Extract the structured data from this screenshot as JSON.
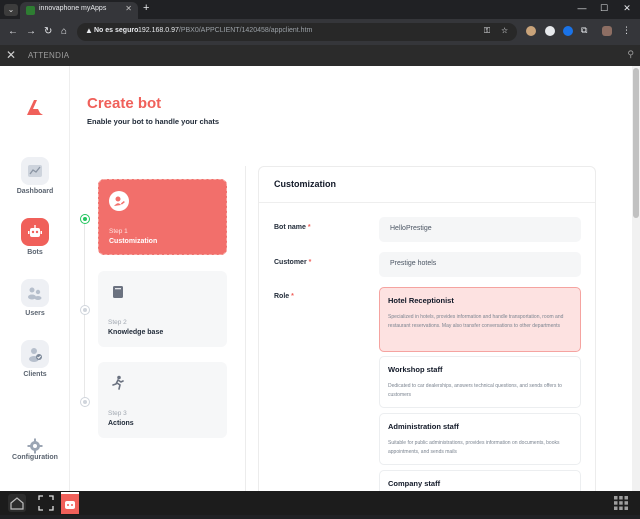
{
  "browser": {
    "tab_title": "innovaphone myApps",
    "security_label": "No es seguro",
    "url_host": "192.168.0.97",
    "url_path": "/PBX0/APPCLIENT/1420458/appclient.htm"
  },
  "appbar": {
    "title": "ATTENDIA"
  },
  "sidebar": {
    "items": [
      {
        "label": "Dashboard",
        "icon": "chart-icon"
      },
      {
        "label": "Bots",
        "icon": "robot-icon",
        "active": true
      },
      {
        "label": "Users",
        "icon": "users-icon"
      },
      {
        "label": "Clients",
        "icon": "client-check-icon"
      },
      {
        "label": "Configuration",
        "icon": "gear-icon"
      }
    ]
  },
  "header": {
    "title": "Create bot",
    "subtitle": "Enable your bot to handle your chats"
  },
  "steps": [
    {
      "number": "Step 1",
      "name": "Customization",
      "icon": "user-edit-icon",
      "active": true
    },
    {
      "number": "Step 2",
      "name": "Knowledge base",
      "icon": "book-icon"
    },
    {
      "number": "Step 3",
      "name": "Actions",
      "icon": "running-icon"
    }
  ],
  "panel": {
    "title": "Customization",
    "fields": {
      "bot_name": {
        "label": "Bot name",
        "required": "*",
        "value": "HelloPrestige"
      },
      "customer": {
        "label": "Customer",
        "required": "*",
        "value": "Prestige hotels"
      },
      "role": {
        "label": "Role",
        "required": "*"
      }
    },
    "roles": [
      {
        "name": "Hotel Receptionist",
        "desc": "Specialized in hotels, provides information and handle transportation, room and restaurant reservations. May also transfer conversations to other departments",
        "selected": true
      },
      {
        "name": "Workshop staff",
        "desc": "Dedicated to car dealerships, answers technical questions, and sends offers to customers"
      },
      {
        "name": "Administration staff",
        "desc": "Suitable for public administrations, provides information on documents, books appointments, and sends mails"
      },
      {
        "name": "Company staff",
        "desc": ""
      }
    ]
  },
  "colors": {
    "accent": "#f0605a",
    "active_step": "#f26f6b",
    "selected_role_bg": "#fde2e1",
    "active_dot": "#22c55e"
  }
}
